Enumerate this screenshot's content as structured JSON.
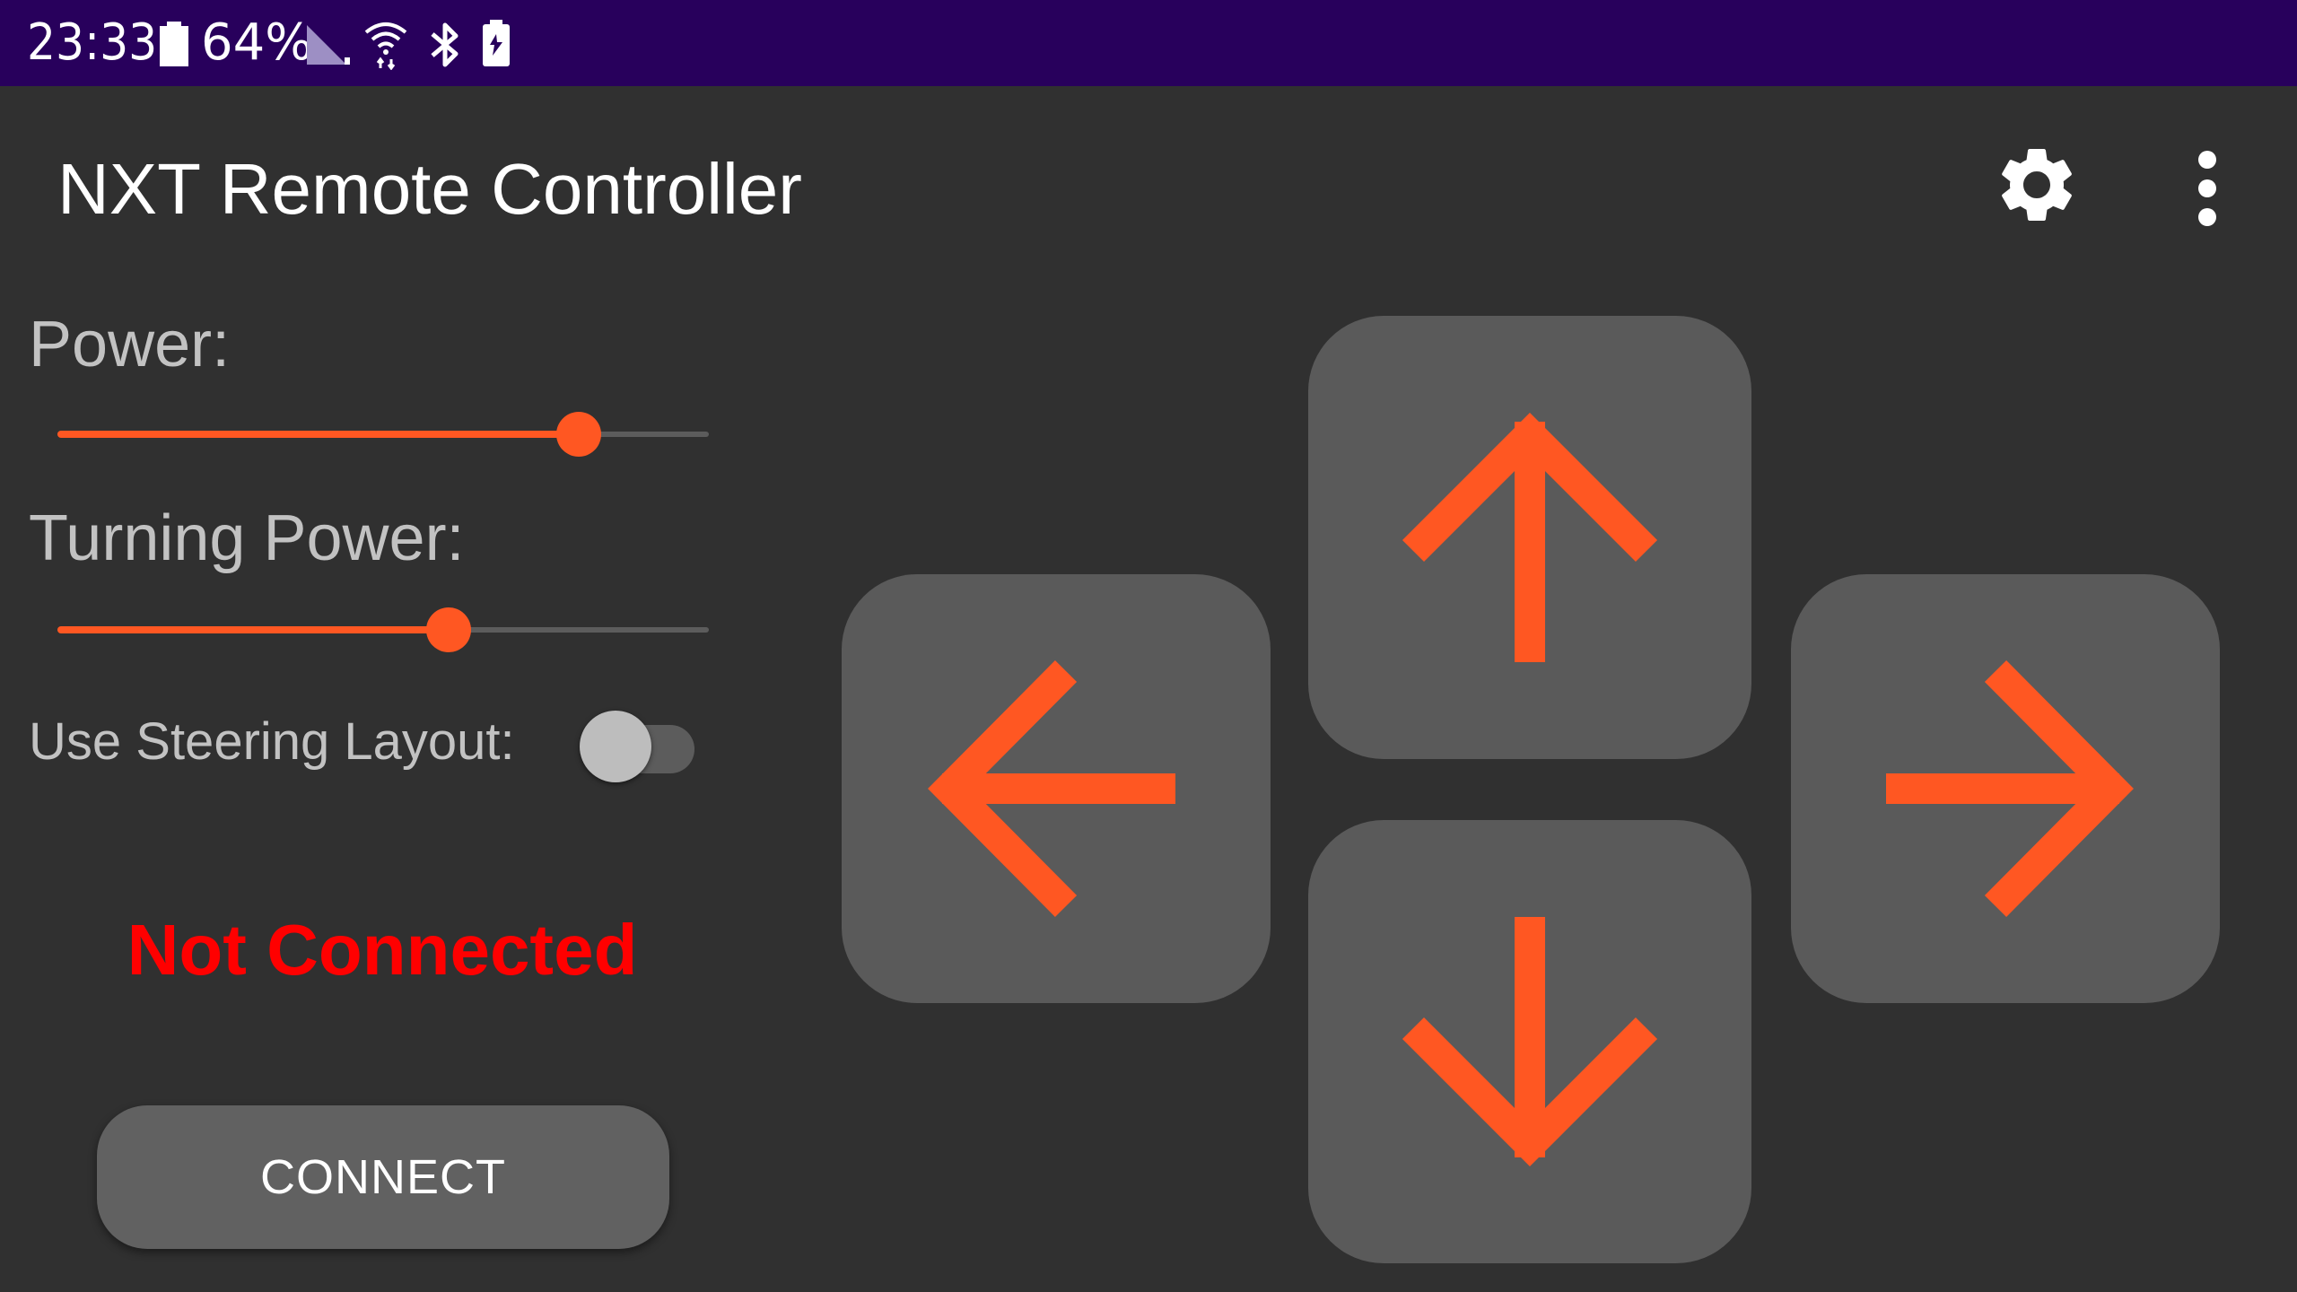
{
  "status_bar": {
    "time": "23:33",
    "battery_percent": "64%",
    "icons": [
      "battery-icon",
      "cell-signal-icon",
      "wifi-icon",
      "bluetooth-icon",
      "battery-saver-icon"
    ]
  },
  "app_bar": {
    "title": "NXT Remote Controller",
    "actions": [
      "settings-icon",
      "overflow-menu-icon"
    ]
  },
  "controls": {
    "power_label": "Power:",
    "power_value": 0.8,
    "turning_power_label": "Turning Power:",
    "turning_power_value": 0.6,
    "steering_layout_label": "Use Steering Layout:",
    "steering_layout_enabled": false
  },
  "connection": {
    "status_text": "Not Connected",
    "connect_label": "CONNECT"
  },
  "dpad": {
    "buttons": [
      "arrow-up-icon",
      "arrow-left-icon",
      "arrow-right-icon",
      "arrow-down-icon"
    ]
  },
  "colors": {
    "status_bar_bg": "#28005c",
    "background": "#303030",
    "accent": "#ff5722",
    "error": "#ff0000",
    "button_bg": "#5a5a5a"
  }
}
